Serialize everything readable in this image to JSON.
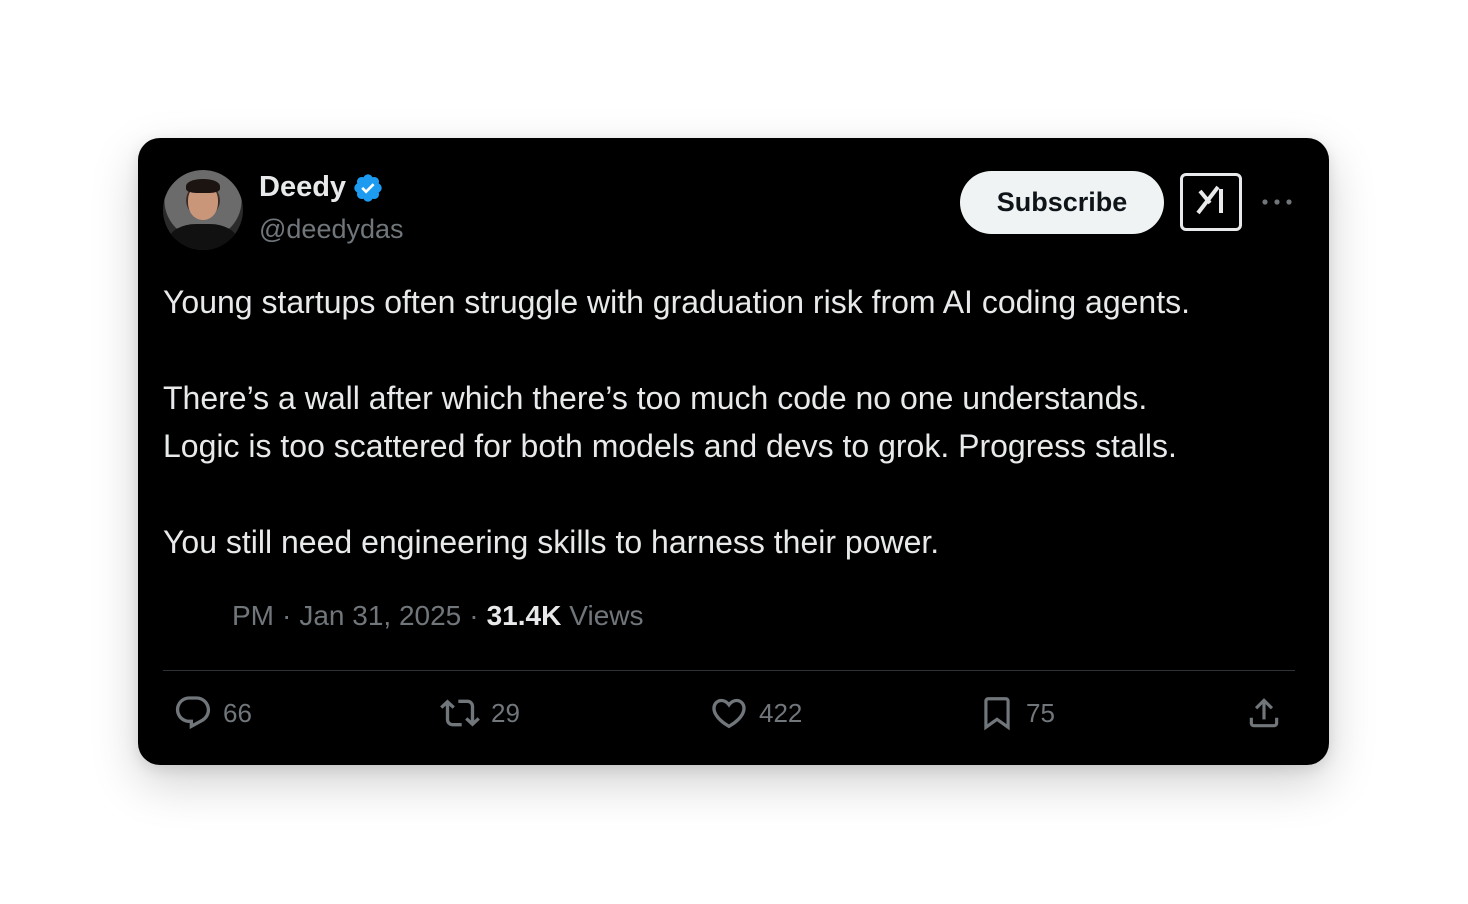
{
  "author": {
    "display_name": "Deedy",
    "handle": "@deedydas",
    "verified": true
  },
  "header_actions": {
    "subscribe_label": "Subscribe",
    "grok_icon": "grok-icon",
    "more_icon": "more-icon"
  },
  "tweet": {
    "paragraphs": [
      "Young startups often struggle with graduation risk from AI coding agents.",
      "There’s a wall after which there’s too much code no one understands.",
      "Logic is too scattered for both models and devs to grok. Progress stalls.",
      "You still need engineering skills to harness their power."
    ]
  },
  "meta": {
    "time": "PM",
    "sep1": "·",
    "date": "Jan 31, 2025",
    "sep2": "·",
    "views_count": "31.4K",
    "views_label": "Views"
  },
  "actions": {
    "replies": "66",
    "reposts": "29",
    "likes": "422",
    "bookmarks": "75"
  },
  "colors": {
    "card_bg": "#000000",
    "text_primary": "#e7e9ea",
    "text_secondary": "#71767b",
    "verified_blue": "#1d9bf0",
    "subscribe_bg": "#eff3f4"
  }
}
